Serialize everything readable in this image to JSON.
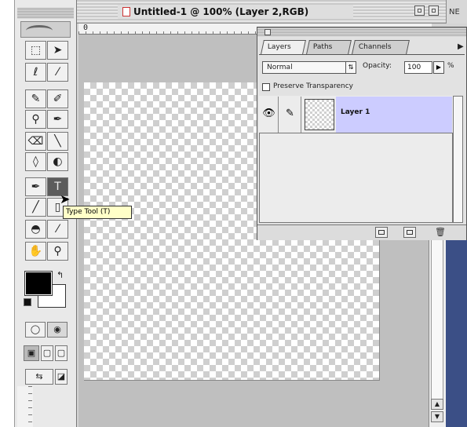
{
  "window": {
    "title": "Untitled-1 @ 100% (Layer 2,RGB)",
    "ruler_h_label": "0",
    "next_window_label": "NE"
  },
  "toolbox": {
    "tools": [
      {
        "name": "marquee-tool",
        "glyph": "⬚"
      },
      {
        "name": "move-tool",
        "glyph": "➤"
      },
      {
        "name": "lasso-tool",
        "glyph": "ℓ"
      },
      {
        "name": "magic-wand-tool",
        "glyph": "⁄"
      },
      {
        "name": "airbrush-tool",
        "glyph": "✎"
      },
      {
        "name": "paintbrush-tool",
        "glyph": "✐"
      },
      {
        "name": "rubber-stamp-tool",
        "glyph": "⚲"
      },
      {
        "name": "history-brush-tool",
        "glyph": "✒"
      },
      {
        "name": "eraser-tool",
        "glyph": "⌫"
      },
      {
        "name": "pencil-tool",
        "glyph": "╲"
      },
      {
        "name": "blur-tool",
        "glyph": "◊"
      },
      {
        "name": "dodge-tool",
        "glyph": "◐"
      },
      {
        "name": "pen-tool",
        "glyph": "✒"
      },
      {
        "name": "type-tool",
        "glyph": "T"
      },
      {
        "name": "measure-tool",
        "glyph": "╱"
      },
      {
        "name": "gradient-tool",
        "glyph": "▯"
      },
      {
        "name": "paint-bucket-tool",
        "glyph": "◓"
      },
      {
        "name": "eyedropper-tool",
        "glyph": "⁄"
      },
      {
        "name": "hand-tool",
        "glyph": "✋"
      },
      {
        "name": "zoom-tool",
        "glyph": "⚲"
      }
    ],
    "tooltip": "Type Tool (T)"
  },
  "layers_palette": {
    "tabs": [
      "Layers",
      "Paths",
      "Channels"
    ],
    "active_tab": "Layers",
    "blend_mode": "Normal",
    "opacity_label": "Opacity:",
    "opacity_value": "100",
    "opacity_unit": "%",
    "preserve_transparency_label": "Preserve Transparency",
    "layers": [
      {
        "name": "Layer 1",
        "visible": true,
        "selected": true
      }
    ]
  },
  "colors": {
    "foreground": "#000000",
    "background": "#ffffff",
    "selected_layer": "#ccccff",
    "tooltip_bg": "#ffffc8"
  }
}
